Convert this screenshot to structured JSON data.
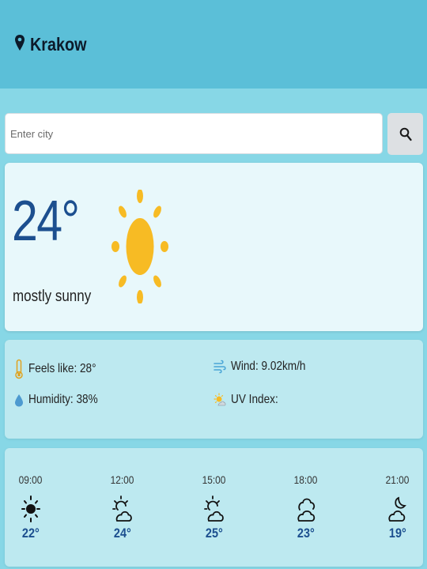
{
  "header": {
    "city": "Krakow",
    "location_icon": "map-pin-icon"
  },
  "search": {
    "placeholder": "Enter city",
    "value": "",
    "button_icon": "search-icon"
  },
  "current": {
    "temperature": "24°",
    "condition": "mostly sunny",
    "icon": "sun-icon",
    "sun_color": "#f7bb24",
    "temp_color": "#1c4f8f"
  },
  "details": {
    "feels_like": {
      "label": "Feels like: 28°",
      "icon": "thermometer-icon"
    },
    "wind": {
      "label": "Wind: 9.02km/h",
      "icon": "wind-icon"
    },
    "humidity": {
      "label": "Humidity: 38%",
      "icon": "droplet-icon"
    },
    "uv_index": {
      "label": "UV Index:",
      "icon": "sun-cloud-icon"
    }
  },
  "forecast": [
    {
      "time": "09:00",
      "temp": "22°",
      "icon": "sun-icon"
    },
    {
      "time": "12:00",
      "temp": "24°",
      "icon": "sun-cloud-icon"
    },
    {
      "time": "15:00",
      "temp": "25°",
      "icon": "sun-cloud-icon"
    },
    {
      "time": "18:00",
      "temp": "23°",
      "icon": "clouds-icon"
    },
    {
      "time": "21:00",
      "temp": "19°",
      "icon": "moon-cloud-icon"
    }
  ]
}
